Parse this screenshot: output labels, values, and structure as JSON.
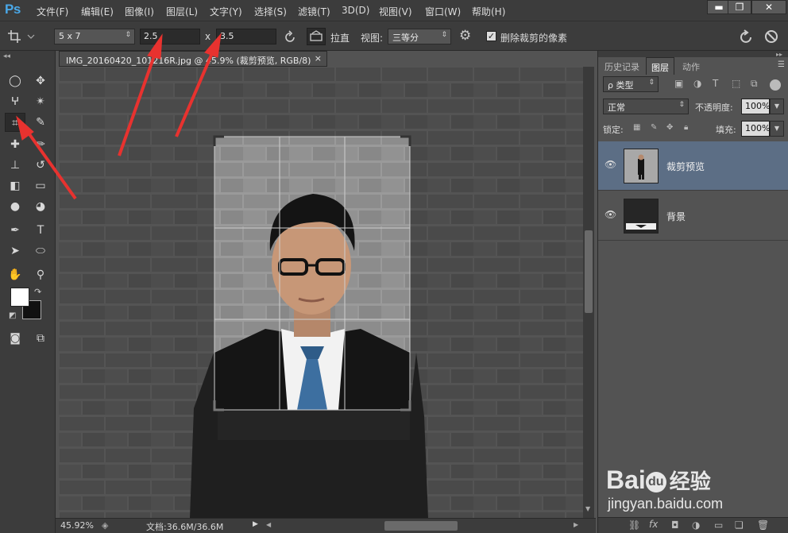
{
  "app": {
    "logo": "Ps"
  },
  "menu": [
    "文件(F)",
    "编辑(E)",
    "图像(I)",
    "图层(L)",
    "文字(Y)",
    "选择(S)",
    "滤镜(T)",
    "3D(D)",
    "视图(V)",
    "窗口(W)",
    "帮助(H)"
  ],
  "window_controls": {
    "minimize": "▬",
    "maximize": "❐",
    "close": "✕"
  },
  "options": {
    "preset": "5 x 7",
    "width": "2.5",
    "separator": "x",
    "height": "3.5",
    "straighten": "拉直",
    "view_label": "视图:",
    "view_value": "三等分",
    "delete_cropped": "删除裁剪的像素",
    "delete_cropped_checked": true
  },
  "document": {
    "tab_title": "IMG_20160420_101216R.jpg @ 45.9% (裁剪预览, RGB/8)",
    "tab_close": "×"
  },
  "status": {
    "zoom": "45.92%",
    "doc_info": "文档:36.6M/36.6M"
  },
  "panel": {
    "tabs": [
      "历史记录",
      "图层",
      "动作"
    ],
    "active_tab": "图层",
    "filter": "ρ 类型",
    "blend_mode": "正常",
    "opacity_label": "不透明度:",
    "opacity": "100%",
    "lock_label": "锁定:",
    "fill_label": "填充:",
    "fill": "100%",
    "layers": [
      {
        "name": "裁剪预览",
        "selected": true
      },
      {
        "name": "背景",
        "selected": false
      }
    ],
    "footer_icons": [
      "link-icon",
      "fx-icon",
      "mask-icon",
      "adjustment-icon",
      "group-icon",
      "new-layer-icon",
      "trash-icon"
    ]
  },
  "watermark": {
    "brand": "Bai",
    "brand2": "du",
    "site_cn": "经验",
    "url": "jingyan.baidu.com"
  },
  "colors": {
    "arrow": "#e8322f",
    "selection_panel": "#5c6e85",
    "logo": "#4aa8e8"
  }
}
